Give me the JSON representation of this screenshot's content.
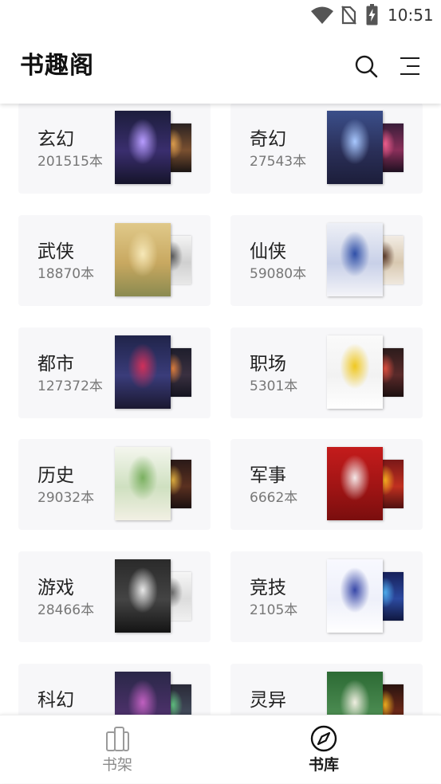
{
  "status_bar": {
    "time": "10:51",
    "icons": [
      "wifi-icon",
      "no-sim-icon",
      "battery-charging-icon"
    ]
  },
  "header": {
    "title": "书趣阁",
    "icons": [
      "search-icon",
      "menu-icon"
    ]
  },
  "colors": {
    "card_background": "#f7f7f9",
    "text_primary": "#222222",
    "text_secondary": "#777777",
    "nav_active": "#1a1a1a",
    "nav_inactive": "#8c8c8c"
  },
  "categories": [
    {
      "name": "玄幻",
      "count": "201515本",
      "main_cover": [
        "#1c1d3c",
        "#3a2e6e",
        "#15142a",
        "#b79cff"
      ],
      "back_cover": [
        "#2a2222",
        "#7a5030",
        "#1a1414",
        "#e0a050"
      ]
    },
    {
      "name": "奇幻",
      "count": "27543本",
      "main_cover": [
        "#3b4f8a",
        "#2a2f58",
        "#1c1e3a",
        "#a8c8ff"
      ],
      "back_cover": [
        "#3a1e3a",
        "#8a2f5a",
        "#1e1020",
        "#f06090"
      ]
    },
    {
      "name": "武侠",
      "count": "18870本",
      "main_cover": [
        "#e0c98a",
        "#c8a860",
        "#8a8a50",
        "#f6e8b8"
      ],
      "back_cover": [
        "#f4f4f4",
        "#d0d0d0",
        "#e8e8e8",
        "#606060"
      ]
    },
    {
      "name": "仙侠",
      "count": "59080本",
      "main_cover": [
        "#eef0f6",
        "#c8d0e8",
        "#f4f4f8",
        "#3050a8"
      ],
      "back_cover": [
        "#f2ece4",
        "#d8c8b0",
        "#efe8de",
        "#604030"
      ]
    },
    {
      "name": "都市",
      "count": "127372本",
      "main_cover": [
        "#20244a",
        "#3a3c7a",
        "#1a1830",
        "#d0305a"
      ],
      "back_cover": [
        "#1e1e2c",
        "#3a3040",
        "#141420",
        "#e08040"
      ]
    },
    {
      "name": "职场",
      "count": "5301本",
      "main_cover": [
        "#fafafa",
        "#f2f2f2",
        "#ffffff",
        "#f0c820"
      ],
      "back_cover": [
        "#2c1c1c",
        "#5a2a2a",
        "#1c1010",
        "#e05040"
      ]
    },
    {
      "name": "历史",
      "count": "29032本",
      "main_cover": [
        "#f4f6ee",
        "#cfe0c0",
        "#f2f0e4",
        "#7ab060"
      ],
      "back_cover": [
        "#2a1a18",
        "#5a3020",
        "#1a1010",
        "#e0b040"
      ]
    },
    {
      "name": "军事",
      "count": "6662本",
      "main_cover": [
        "#c41c1c",
        "#a01414",
        "#7a0e0e",
        "#f4e8e8"
      ],
      "back_cover": [
        "#7a1818",
        "#c03020",
        "#501010",
        "#f8b020"
      ]
    },
    {
      "name": "游戏",
      "count": "28466本",
      "main_cover": [
        "#2a2a2a",
        "#444444",
        "#141414",
        "#e8e8e8"
      ],
      "back_cover": [
        "#f6f6f6",
        "#dcdcdc",
        "#f0f0f0",
        "#707070"
      ]
    },
    {
      "name": "竞技",
      "count": "2105本",
      "main_cover": [
        "#f8f9ff",
        "#eef0fa",
        "#ffffff",
        "#3848a8"
      ],
      "back_cover": [
        "#16205a",
        "#2c4aa0",
        "#101840",
        "#50b0f0"
      ]
    },
    {
      "name": "科幻",
      "main_cover": [
        "#2a2848",
        "#4a3068",
        "#1a1830",
        "#c060c0"
      ],
      "back_cover": [
        "#2a2a38",
        "#404858",
        "#1c1c28",
        "#60c080"
      ]
    },
    {
      "name": "灵异",
      "main_cover": [
        "#2c6a34",
        "#4a8a50",
        "#20481e",
        "#efeee0"
      ],
      "back_cover": [
        "#2a1410",
        "#6a2818",
        "#1a0c08",
        "#f0b020"
      ]
    }
  ],
  "bottom_nav": {
    "items": [
      {
        "label": "书架",
        "icon": "bookshelf-icon",
        "active": false
      },
      {
        "label": "书库",
        "icon": "compass-icon",
        "active": true
      }
    ]
  }
}
